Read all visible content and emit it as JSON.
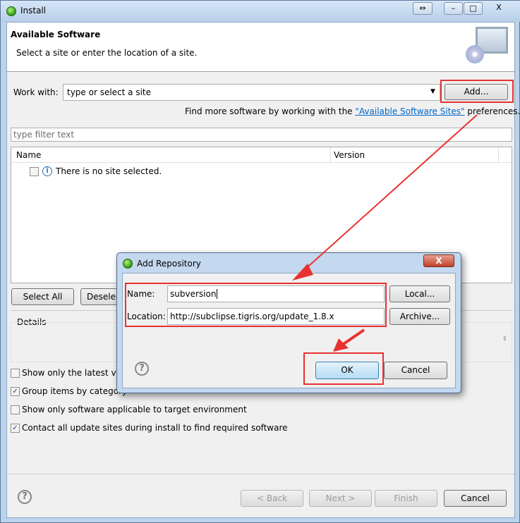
{
  "window": {
    "title": "Install",
    "controls": {
      "restore": "⇔",
      "minimize": "–",
      "maximize": "□",
      "close": "X"
    }
  },
  "header": {
    "title": "Available Software",
    "subtitle": "Select a site or enter the location of a site."
  },
  "work_with": {
    "label": "Work with:",
    "placeholder": "type or select a site",
    "add_button": "Add...",
    "find_more_prefix": "Find more software by working with the ",
    "link": "\"Available Software Sites\"",
    "find_more_suffix": " preferences."
  },
  "filter": {
    "placeholder": "type filter text"
  },
  "table": {
    "columns": [
      "Name",
      "Version"
    ],
    "rows": [
      {
        "name": "There is no site selected.",
        "checked": false
      }
    ]
  },
  "buttons": {
    "select_all": "Select All",
    "deselect_all": "Deselect All"
  },
  "details": {
    "label": "Details"
  },
  "options": [
    {
      "label": "Show only the latest versions of available software",
      "checked": false
    },
    {
      "label": "Group items by category",
      "checked": true
    },
    {
      "label": "Show only software applicable to target environment",
      "checked": false
    },
    {
      "label": "Contact all update sites during install to find required software",
      "checked": true
    }
  ],
  "footer": {
    "back": "< Back",
    "next": "Next >",
    "finish": "Finish",
    "cancel": "Cancel"
  },
  "dialog": {
    "title": "Add Repository",
    "close": "X",
    "name_label": "Name:",
    "name_value": "subversion",
    "location_label": "Location:",
    "location_value": "http://subclipse.tigris.org/update_1.8.x",
    "local_button": "Local...",
    "archive_button": "Archive...",
    "ok": "OK",
    "cancel": "Cancel"
  },
  "colors": {
    "annotation": "#e8322f",
    "link": "#0066cc",
    "ok_button": "#cde8f8"
  }
}
